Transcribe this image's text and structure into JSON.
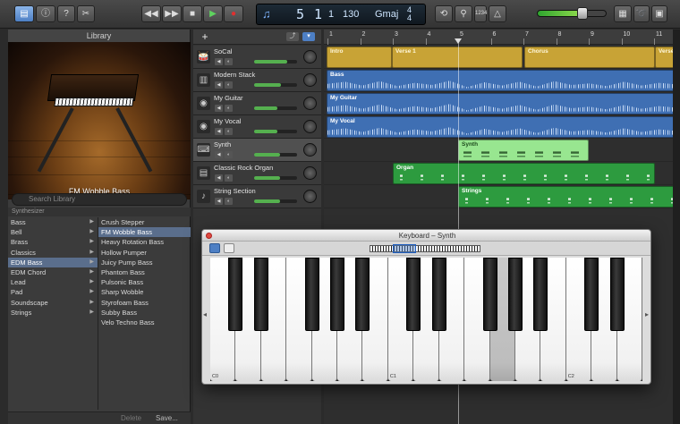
{
  "toolbar": {
    "library_icon": "library-icon",
    "transport": {
      "rewind": "◀◀",
      "forward": "▶▶",
      "stop": "■",
      "play": "▶",
      "record": "●"
    },
    "lcd": {
      "position": "5 1",
      "beat": "1",
      "bpm": "130",
      "key": "Gmaj",
      "signature_top": "4",
      "signature_bottom": "4"
    },
    "count_in": "1234"
  },
  "library": {
    "title": "Library",
    "patch_name": "FM Wobble Bass",
    "search_placeholder": "Search Library",
    "category_header": "Synthesizer",
    "categories": [
      "Bass",
      "Bell",
      "Brass",
      "Classics",
      "EDM Bass",
      "EDM Chord",
      "Lead",
      "Pad",
      "Soundscape",
      "Strings"
    ],
    "selected_category": "EDM Bass",
    "patches": [
      "Crush Stepper",
      "FM Wobble Bass",
      "Heavy Rotation Bass",
      "Hollow Pumper",
      "Juicy Pump Bass",
      "Phantom Bass",
      "Pulsonic Bass",
      "Sharp Wobble",
      "Styrofoam Bass",
      "Subby Bass",
      "Velo Techno Bass"
    ],
    "selected_patch": "FM Wobble Bass",
    "delete_label": "Delete",
    "save_label": "Save..."
  },
  "tracks": [
    {
      "name": "SoCal",
      "icon": "drum-icon",
      "volume": 0.78
    },
    {
      "name": "Modern Stack",
      "icon": "amp-icon",
      "volume": 0.62
    },
    {
      "name": "My Guitar",
      "icon": "mic-icon",
      "volume": 0.55
    },
    {
      "name": "My Vocal",
      "icon": "mic-icon",
      "volume": 0.55
    },
    {
      "name": "Synth",
      "icon": "keyboard-icon",
      "volume": 0.6
    },
    {
      "name": "Classic Rock Organ",
      "icon": "organ-icon",
      "volume": 0.6
    },
    {
      "name": "String Section",
      "icon": "violin-icon",
      "volume": 0.6
    }
  ],
  "ruler": [
    "1",
    "2",
    "3",
    "4",
    "5",
    "6",
    "7",
    "8",
    "9",
    "10",
    "11"
  ],
  "regions": {
    "socal": [
      "Intro",
      "Verse 1",
      "",
      "Chorus",
      "Verse"
    ],
    "bass": "Bass",
    "guitar": "My Guitar",
    "vocal": "My Vocal",
    "synth": "Synth",
    "organ": "Organ",
    "strings": "Strings"
  },
  "keyboard": {
    "title": "Keyboard – Synth",
    "octave_labels": [
      "C0",
      "C1",
      "C2"
    ]
  }
}
